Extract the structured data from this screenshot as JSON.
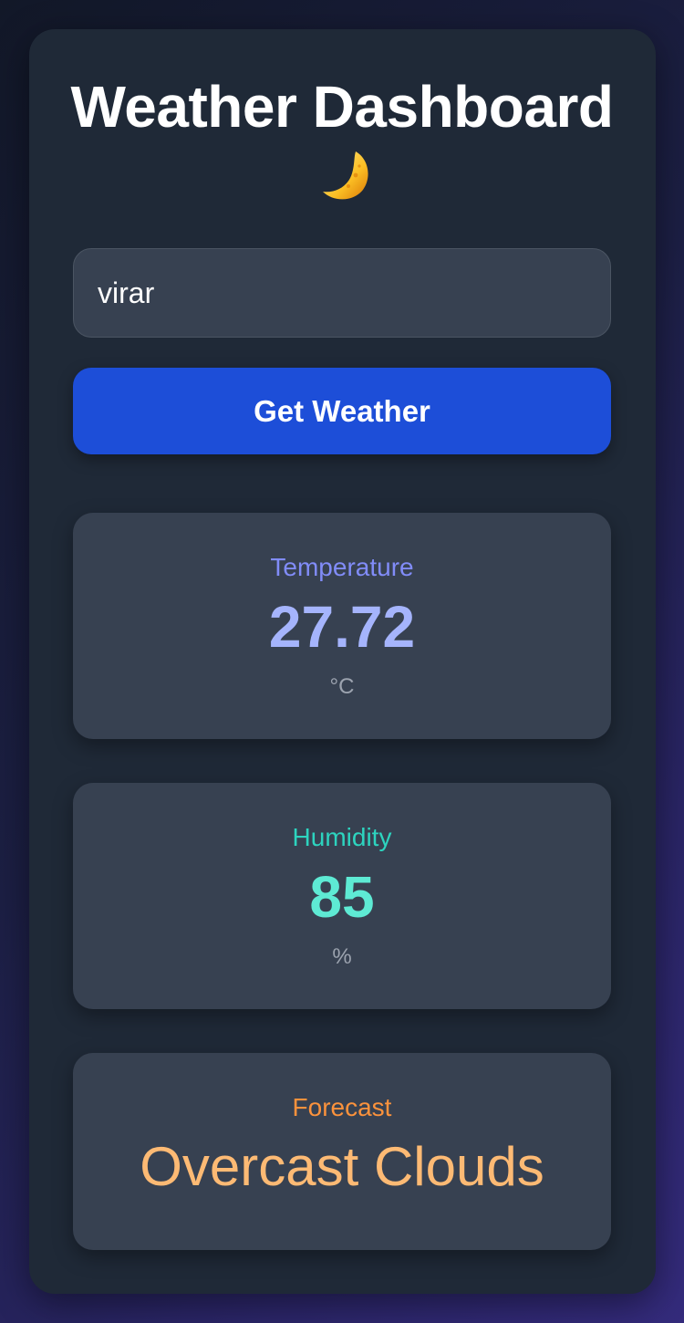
{
  "header": {
    "title": "Weather Dashboard",
    "icon": "crescent-moon-icon"
  },
  "search": {
    "value": "virar",
    "button_label": "Get Weather"
  },
  "stats": {
    "temperature": {
      "label": "Temperature",
      "value": "27.72",
      "unit": "°C",
      "label_color": "#818cf8",
      "value_color": "#a5b4fc"
    },
    "humidity": {
      "label": "Humidity",
      "value": "85",
      "unit": "%",
      "label_color": "#2dd4bf",
      "value_color": "#5eead4"
    },
    "forecast": {
      "label": "Forecast",
      "value": "Overcast Clouds",
      "label_color": "#fb923c",
      "value_color": "#fdba74"
    }
  },
  "colors": {
    "card_bg": "#1f2937",
    "panel_bg": "#374151",
    "button_bg": "#1d4ed8"
  }
}
